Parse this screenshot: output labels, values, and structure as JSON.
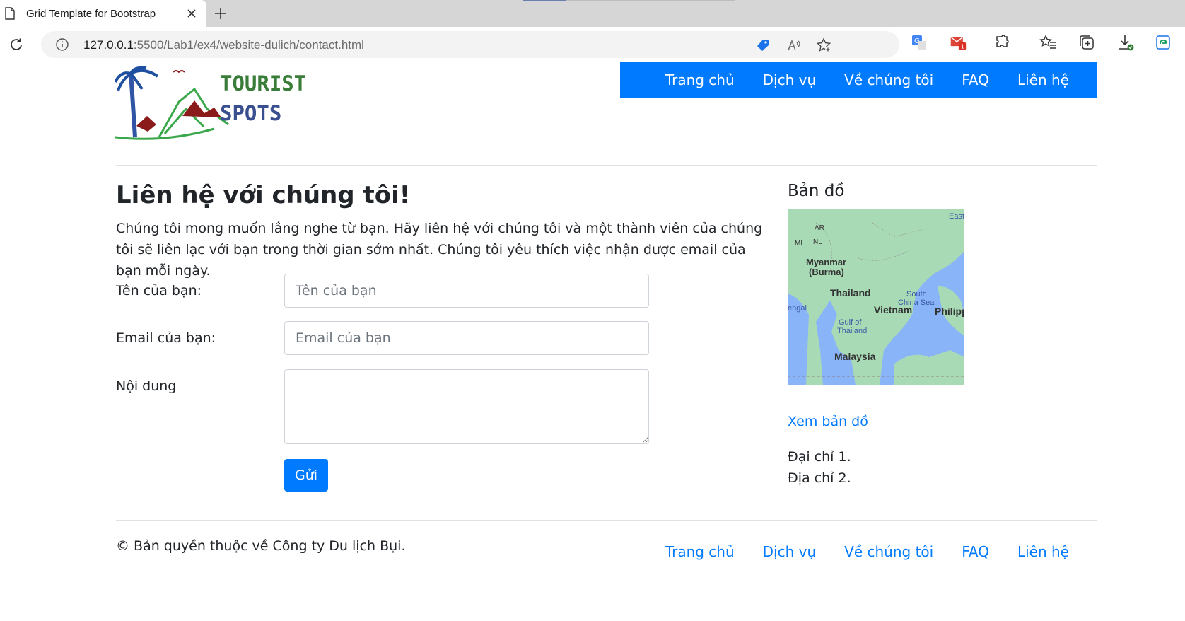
{
  "browser": {
    "tab_title": "Grid Template for Bootstrap",
    "url_host": "127.0.0.1",
    "url_rest": ":5500/Lab1/ex4/website-dulich/contact.html",
    "mail_badge": "1"
  },
  "logo": {
    "line1": "TOURIST",
    "line2": "SPOTS"
  },
  "nav": [
    "Trang chủ",
    "Dịch vụ",
    "Về chúng tôi",
    "FAQ",
    "Liên hệ"
  ],
  "contact": {
    "title": "Liên hệ với chúng tôi!",
    "lead": "Chúng tôi mong muốn lắng nghe từ bạn. Hãy liên hệ với chúng tôi và một thành viên của chúng tôi sẽ liên lạc với bạn trong thời gian sớm nhất. Chúng tôi yêu thích việc nhận được email của bạn mỗi ngày.",
    "name_label": "Tên của bạn:",
    "name_placeholder": "Tên của bạn",
    "email_label": "Email của bạn:",
    "email_placeholder": "Email của bạn",
    "message_label": "Nội dung",
    "submit": "Gửi"
  },
  "sidebar": {
    "map_title": "Bản đồ",
    "map_labels": {
      "east": "East",
      "ar": "AR",
      "ml": "ML",
      "nl": "NL",
      "myanmar1": "Myanmar",
      "myanmar2": "(Burma)",
      "thailand": "Thailand",
      "south1": "South",
      "south2": "China Sea",
      "bengal": "engal",
      "vietnam": "Vietnam",
      "philipp": "Philipp",
      "gulf1": "Gulf of",
      "gulf2": "Thailand",
      "malaysia": "Malaysia"
    },
    "map_link": "Xem bản đồ",
    "address1": "Đại chỉ 1.",
    "address2": "Địa chỉ 2."
  },
  "footer": {
    "copyright": "© Bản quyền thuộc về Công ty Du lịch Bụi.",
    "nav": [
      "Trang chủ",
      "Dịch vụ",
      "Về chúng tôi",
      "FAQ",
      "Liên hệ"
    ]
  },
  "colors": {
    "primary": "#007bff",
    "sea": "#8ab4f8",
    "land": "#a8dab5"
  }
}
